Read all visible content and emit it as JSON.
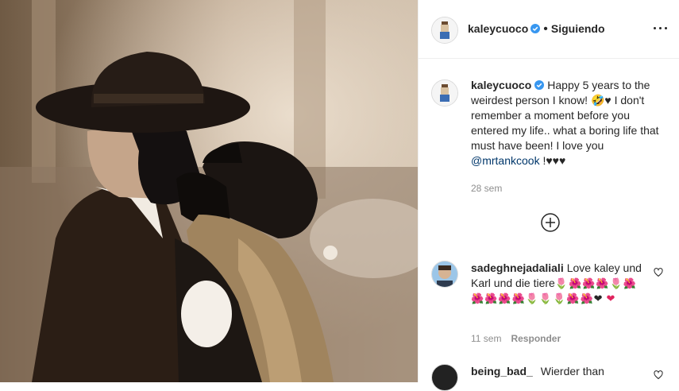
{
  "post": {
    "username": "kaleycuoco",
    "follow_label": "Siguiendo",
    "dot": "•"
  },
  "caption": {
    "username": "kaleycuoco",
    "text_1": "Happy 5 years to the weirdest person I know! 🤣♥ I don't remember a moment before you entered my life.. what a boring life that must have been! I love you ",
    "mention": "@mrtankcook",
    "text_2": " !♥♥♥",
    "time": "28 sem"
  },
  "comments": [
    {
      "username": "sadeghnejadaliali",
      "text": "Love kaley und Karl und die tiere",
      "emojis_line1": "🌷🌺🌺🌺🌷🌺",
      "emojis_line2": "🌺🌺🌺🌺🌷🌷🌷🌺🌺❤",
      "emojis_line3": "❤",
      "time": "11 sem",
      "reply_label": "Responder"
    },
    {
      "username": "being_bad_",
      "text": "Wierder than"
    }
  ],
  "colors": {
    "text": "#262626",
    "secondary": "#8e8e8e",
    "link": "#00376b",
    "verified": "#3897f0"
  },
  "icons": [
    "verified-icon",
    "more-options-icon",
    "load-more-comments-icon",
    "like-icon"
  ]
}
